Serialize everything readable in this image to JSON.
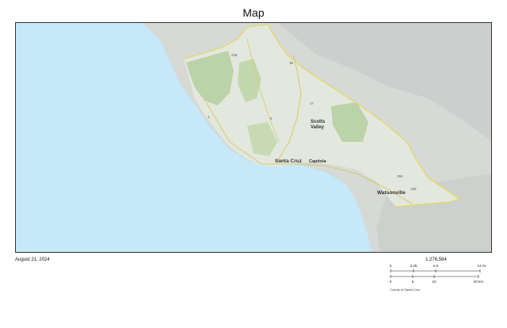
{
  "title": "Map",
  "footer": {
    "date": "August 21, 2024",
    "scale_ratio": "1:276,584",
    "credit": "County of Santa Cruz"
  },
  "scale_bar": {
    "mi_labels": [
      "0",
      "3.25",
      "6.5",
      "13 mi"
    ],
    "km_labels": [
      "0",
      "5",
      "10",
      "20 km"
    ]
  },
  "map": {
    "places": [
      {
        "name": "Scotts",
        "kind": "city"
      },
      {
        "name": "Valley",
        "kind": "city"
      },
      {
        "name": "Santa Cruz",
        "kind": "city"
      },
      {
        "name": "Capitola",
        "kind": "city"
      },
      {
        "name": "Watsonville",
        "kind": "city"
      }
    ],
    "route_shields": [
      "1",
      "9",
      "17",
      "35",
      "129",
      "152",
      "236"
    ],
    "colors": {
      "ocean": "#c5e9f8",
      "land": "#d9dcd8",
      "county": "#e4e9df",
      "parks": "#bcd2a8",
      "boundary": "#e5d86a"
    }
  }
}
